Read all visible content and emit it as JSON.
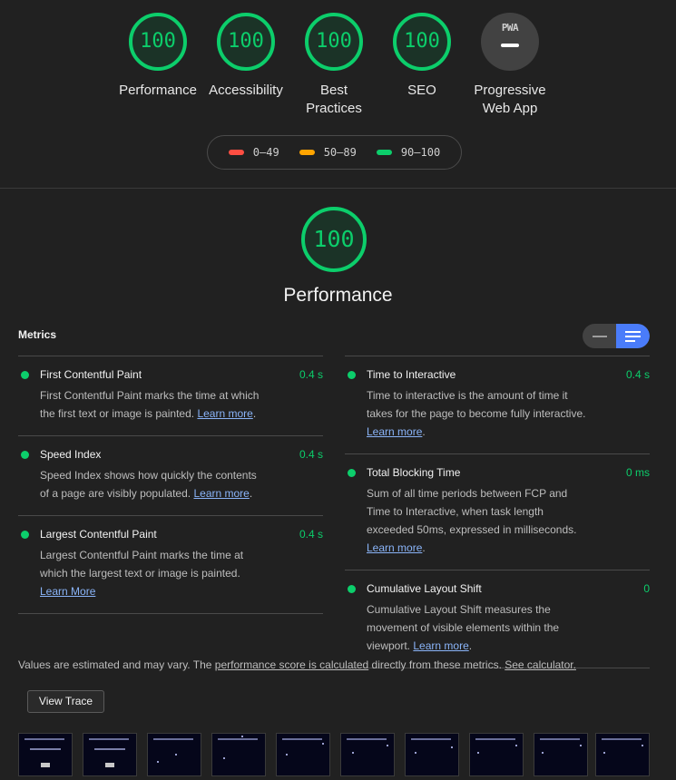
{
  "categories": [
    {
      "score": "100",
      "label": "Performance"
    },
    {
      "score": "100",
      "label": "Accessibility"
    },
    {
      "score": "100",
      "label": "Best Practices"
    },
    {
      "score": "100",
      "label": "SEO"
    },
    {
      "score": "",
      "icon_text": "PWA",
      "label": "Progressive Web App"
    }
  ],
  "legend": [
    {
      "range": "0–49",
      "color": "#ff4e42"
    },
    {
      "range": "50–89",
      "color": "#ffa400"
    },
    {
      "range": "90–100",
      "color": "#0cce6b"
    }
  ],
  "main": {
    "score": "100",
    "title": "Performance"
  },
  "metrics": {
    "heading": "Metrics",
    "left": [
      {
        "title": "First Contentful Paint",
        "value": "0.4 s",
        "desc": "First Contentful Paint marks the time at which the first text or image is painted.",
        "link": "Learn more"
      },
      {
        "title": "Speed Index",
        "value": "0.4 s",
        "desc": "Speed Index shows how quickly the contents of a page are visibly populated.",
        "link": "Learn more"
      },
      {
        "title": "Largest Contentful Paint",
        "value": "0.4 s",
        "desc": "Largest Contentful Paint marks the time at which the largest text or image is painted.",
        "link": "Learn More"
      }
    ],
    "right": [
      {
        "title": "Time to Interactive",
        "value": "0.4 s",
        "desc": "Time to interactive is the amount of time it takes for the page to become fully interactive.",
        "link": "Learn more"
      },
      {
        "title": "Total Blocking Time",
        "value": "0 ms",
        "desc": "Sum of all time periods between FCP and Time to Interactive, when task length exceeded 50ms, expressed in milliseconds.",
        "link": "Learn more"
      },
      {
        "title": "Cumulative Layout Shift",
        "value": "0",
        "desc": "Cumulative Layout Shift measures the movement of visible elements within the viewport.",
        "link": "Learn more"
      }
    ]
  },
  "note": {
    "prefix": "Values are estimated and may vary. The ",
    "link1": "performance score is calculated",
    "middle": " directly from these metrics. ",
    "link2": "See calculator."
  },
  "view_trace": "View Trace",
  "colors": {
    "pass": "#0cce6b",
    "background": "#212121",
    "accent": "#4a7cfa"
  }
}
